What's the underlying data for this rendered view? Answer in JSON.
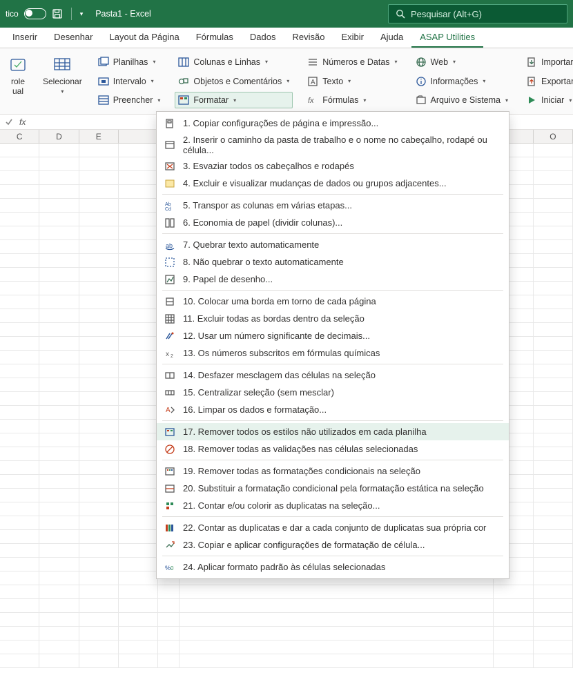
{
  "title_bar": {
    "auto_save_partial": "tico",
    "doc_title": "Pasta1  -  Excel",
    "search_placeholder": "Pesquisar (Alt+G)"
  },
  "tabs": {
    "items": [
      "Inserir",
      "Desenhar",
      "Layout da Página",
      "Fórmulas",
      "Dados",
      "Revisão",
      "Exibir",
      "Ajuda",
      "ASAP Utilities"
    ],
    "active_index": 8
  },
  "ribbon": {
    "big": [
      {
        "label": "role\nual"
      },
      {
        "label": "Selecionar"
      }
    ],
    "col1": [
      {
        "label": "Planilhas"
      },
      {
        "label": "Intervalo"
      },
      {
        "label": "Preencher"
      }
    ],
    "col2": [
      {
        "label": "Colunas e Linhas"
      },
      {
        "label": "Objetos e Comentários"
      },
      {
        "label": "Formatar"
      }
    ],
    "col3": [
      {
        "label": "Números e Datas"
      },
      {
        "label": "Texto"
      },
      {
        "label": "Fórmulas"
      }
    ],
    "col4": [
      {
        "label": "Web"
      },
      {
        "label": "Informações"
      },
      {
        "label": "Arquivo e Sistema"
      }
    ],
    "col5": [
      {
        "label": "Importar"
      },
      {
        "label": "Exportar"
      },
      {
        "label": "Iniciar"
      }
    ]
  },
  "columns": {
    "widths": [
      64,
      64,
      64,
      64,
      34,
      510,
      64,
      64
    ],
    "labels": [
      "C",
      "D",
      "E",
      "",
      "",
      "",
      "",
      "O"
    ]
  },
  "menu": {
    "highlight_index": 16,
    "items": [
      "1.  Copiar configurações de página e impressão...",
      "2.  Inserir o caminho da pasta de trabalho e o nome no cabeçalho, rodapé ou célula...",
      "3.  Esvaziar todos os cabeçalhos e rodapés",
      "4.  Excluir e visualizar mudanças de dados ou grupos adjacentes...",
      "5.  Transpor as colunas em várias etapas...",
      "6.  Economia de papel (dividir colunas)...",
      "7.  Quebrar texto automaticamente",
      "8.  Não quebrar o texto automaticamente",
      "9.  Papel de desenho...",
      "10.  Colocar uma borda em torno de cada página",
      "11.  Excluir todas as bordas dentro da seleção",
      "12.  Usar um número significante de decimais...",
      "13.  Os números subscritos em fórmulas químicas",
      "14.  Desfazer mesclagem das células na seleção",
      "15.  Centralizar seleção (sem mesclar)",
      "16.  Limpar os dados e formatação...",
      "17.  Remover todos os estilos não utilizados em cada planilha",
      "18.  Remover todas as validações nas células selecionadas",
      "19.  Remover todas as formatações condicionais na seleção",
      "20.  Substituir a formatação condicional pela formatação estática na seleção",
      "21.  Contar e/ou colorir as duplicatas na seleção...",
      "22.  Contar as duplicatas e dar a cada conjunto de duplicatas sua própria cor",
      "23.  Copiar e aplicar configurações de formatação de célula...",
      "24.  Aplicar formato padrão às células selecionadas"
    ]
  }
}
